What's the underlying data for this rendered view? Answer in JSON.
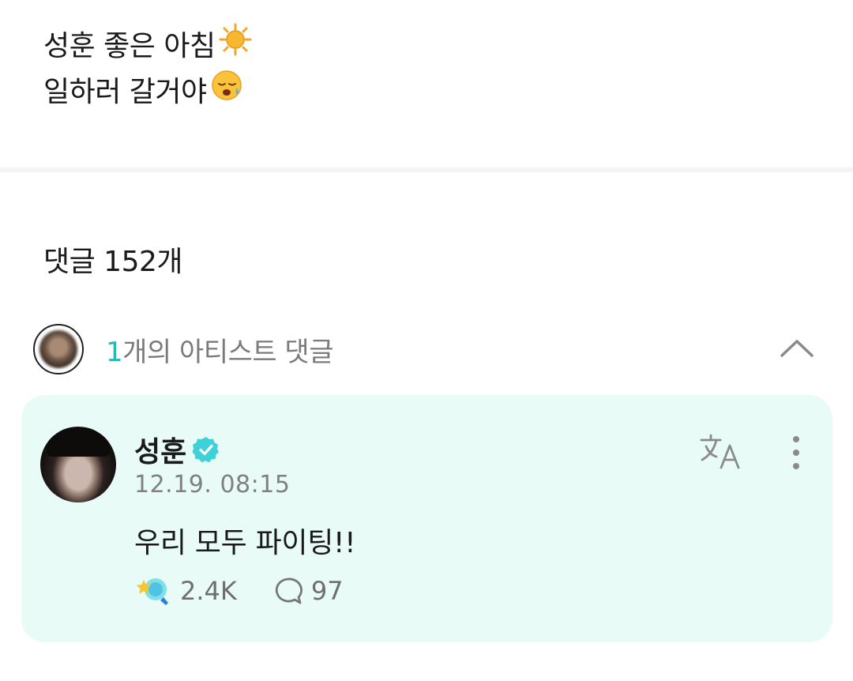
{
  "post": {
    "line1": "성훈 좋은 아침",
    "line1_emoji": "sun-emoji",
    "line2": "일하러 갈거야",
    "line2_emoji": "sleepy-face-emoji"
  },
  "comments_header": {
    "label": "댓글 152개"
  },
  "artist_comments": {
    "count": "1",
    "label": "개의 아티스트 댓글"
  },
  "comment": {
    "username": "성훈",
    "verified_icon": "verified-badge-icon",
    "timestamp": "12.19. 08:15",
    "text": "우리 모두 파이팅!!",
    "likes": "2.4K",
    "replies": "97"
  },
  "colors": {
    "accent": "#24b8b6",
    "card_background": "#e9fbf7",
    "verified": "#3fd0d8"
  }
}
